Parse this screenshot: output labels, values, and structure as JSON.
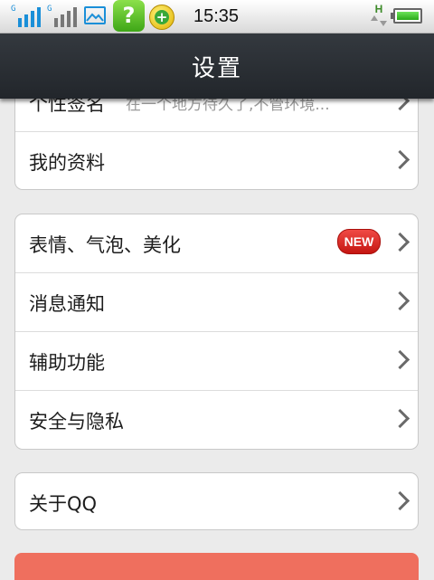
{
  "status_bar": {
    "time": "15:35",
    "signal1_tag": "G",
    "signal2_tag": "G",
    "help_glyph": "?",
    "plus_glyph": "+",
    "data_glyph": "H"
  },
  "header": {
    "title": "设置"
  },
  "groups": [
    {
      "rows": [
        {
          "label": "个性签名",
          "value": "在一个地方待久了,不管环境..."
        },
        {
          "label": "我的资料"
        }
      ]
    },
    {
      "rows": [
        {
          "label": "表情、气泡、美化",
          "badge": "NEW"
        },
        {
          "label": "消息通知"
        },
        {
          "label": "辅助功能"
        },
        {
          "label": "安全与隐私"
        }
      ]
    },
    {
      "rows": [
        {
          "label": "关于QQ"
        }
      ]
    }
  ]
}
